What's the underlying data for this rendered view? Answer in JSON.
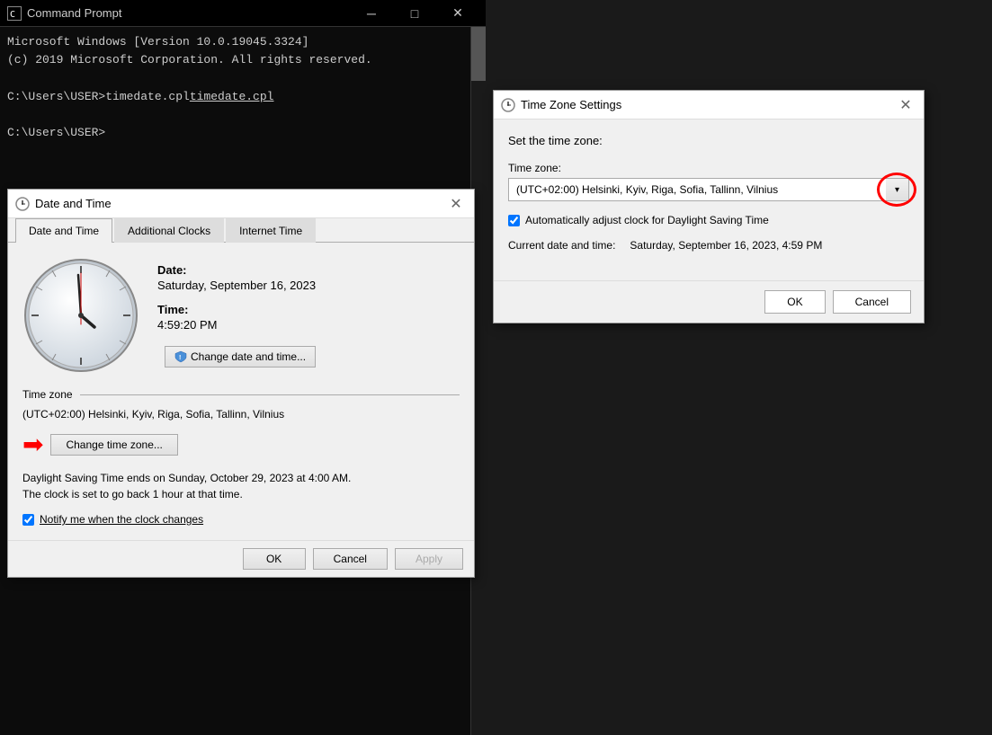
{
  "cmd": {
    "title": "Command Prompt",
    "line1": "Microsoft Windows [Version 10.0.19045.3324]",
    "line2": "(c) 2019 Microsoft Corporation. All rights reserved.",
    "line3": "",
    "prompt1": "C:\\Users\\USER>timedate.cpl",
    "prompt2": "C:\\Users\\USER>"
  },
  "datetime_dialog": {
    "title": "Date and Time",
    "tabs": [
      "Date and Time",
      "Additional Clocks",
      "Internet Time"
    ],
    "date_label": "Date:",
    "date_value": "Saturday, September 16, 2023",
    "time_label": "Time:",
    "time_value": "4:59:20 PM",
    "change_date_btn": "Change date and time...",
    "timezone_section": "Time zone",
    "timezone_value": "(UTC+02:00) Helsinki, Kyiv, Riga, Sofia, Tallinn, Vilnius",
    "change_tz_btn": "Change time zone...",
    "dst_note": "Daylight Saving Time ends on Sunday, October 29, 2023 at 4:00 AM.\nThe clock is set to go back 1 hour at that time.",
    "notify_label": "Notify me when the clock changes",
    "footer": {
      "ok": "OK",
      "cancel": "Cancel",
      "apply": "Apply"
    }
  },
  "tz_dialog": {
    "title": "Time Zone Settings",
    "description": "Set the time zone:",
    "tz_label": "Time zone:",
    "tz_value": "(UTC+02:00) Helsinki, Kyiv, Riga, Sofia, Tallinn, Vilnius",
    "dst_checkbox": "Automatically adjust clock for Daylight Saving Time",
    "current_label": "Current date and time:",
    "current_value": "Saturday, September 16, 2023, 4:59 PM",
    "ok_btn": "OK",
    "cancel_btn": "Cancel"
  }
}
